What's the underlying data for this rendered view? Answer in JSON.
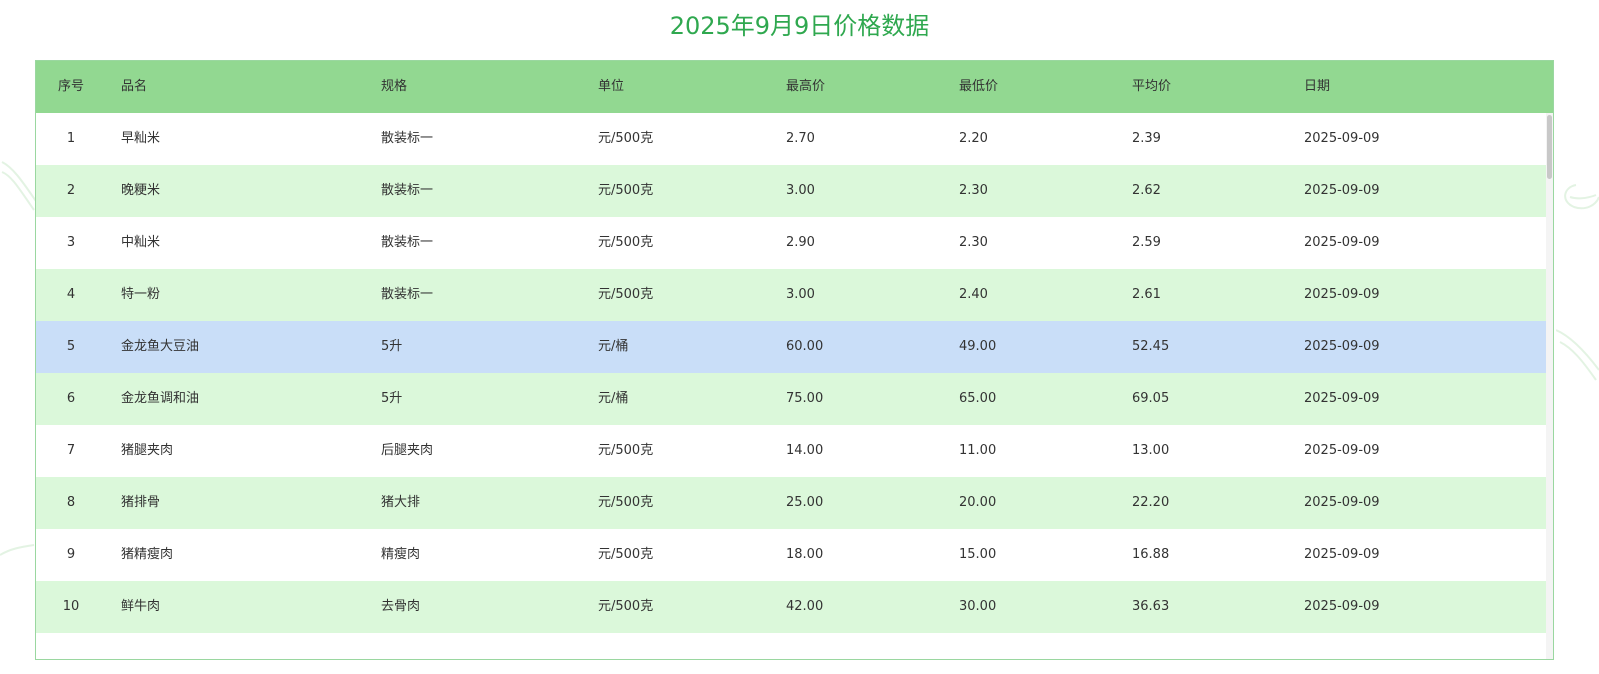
{
  "title": "2025年9月9日价格数据",
  "colors": {
    "title": "#2fa84f",
    "header_bg": "#92d891",
    "row_alt_bg": "#dbf8da",
    "row_highlight_bg": "#c9def8"
  },
  "table": {
    "headers": [
      "序号",
      "品名",
      "规格",
      "单位",
      "最高价",
      "最低价",
      "平均价",
      "日期"
    ],
    "highlighted_row": 5,
    "rows": [
      [
        "1",
        "早籼米",
        "散装标一",
        "元/500克",
        "2.70",
        "2.20",
        "2.39",
        "2025-09-09"
      ],
      [
        "2",
        "晚粳米",
        "散装标一",
        "元/500克",
        "3.00",
        "2.30",
        "2.62",
        "2025-09-09"
      ],
      [
        "3",
        "中籼米",
        "散装标一",
        "元/500克",
        "2.90",
        "2.30",
        "2.59",
        "2025-09-09"
      ],
      [
        "4",
        "特一粉",
        "散装标一",
        "元/500克",
        "3.00",
        "2.40",
        "2.61",
        "2025-09-09"
      ],
      [
        "5",
        "金龙鱼大豆油",
        "5升",
        "元/桶",
        "60.00",
        "49.00",
        "52.45",
        "2025-09-09"
      ],
      [
        "6",
        "金龙鱼调和油",
        "5升",
        "元/桶",
        "75.00",
        "65.00",
        "69.05",
        "2025-09-09"
      ],
      [
        "7",
        "猪腿夹肉",
        "后腿夹肉",
        "元/500克",
        "14.00",
        "11.00",
        "13.00",
        "2025-09-09"
      ],
      [
        "8",
        "猪排骨",
        "猪大排",
        "元/500克",
        "25.00",
        "20.00",
        "22.20",
        "2025-09-09"
      ],
      [
        "9",
        "猪精瘦肉",
        "精瘦肉",
        "元/500克",
        "18.00",
        "15.00",
        "16.88",
        "2025-09-09"
      ],
      [
        "10",
        "鲜牛肉",
        "去骨肉",
        "元/500克",
        "42.00",
        "30.00",
        "36.63",
        "2025-09-09"
      ]
    ]
  }
}
